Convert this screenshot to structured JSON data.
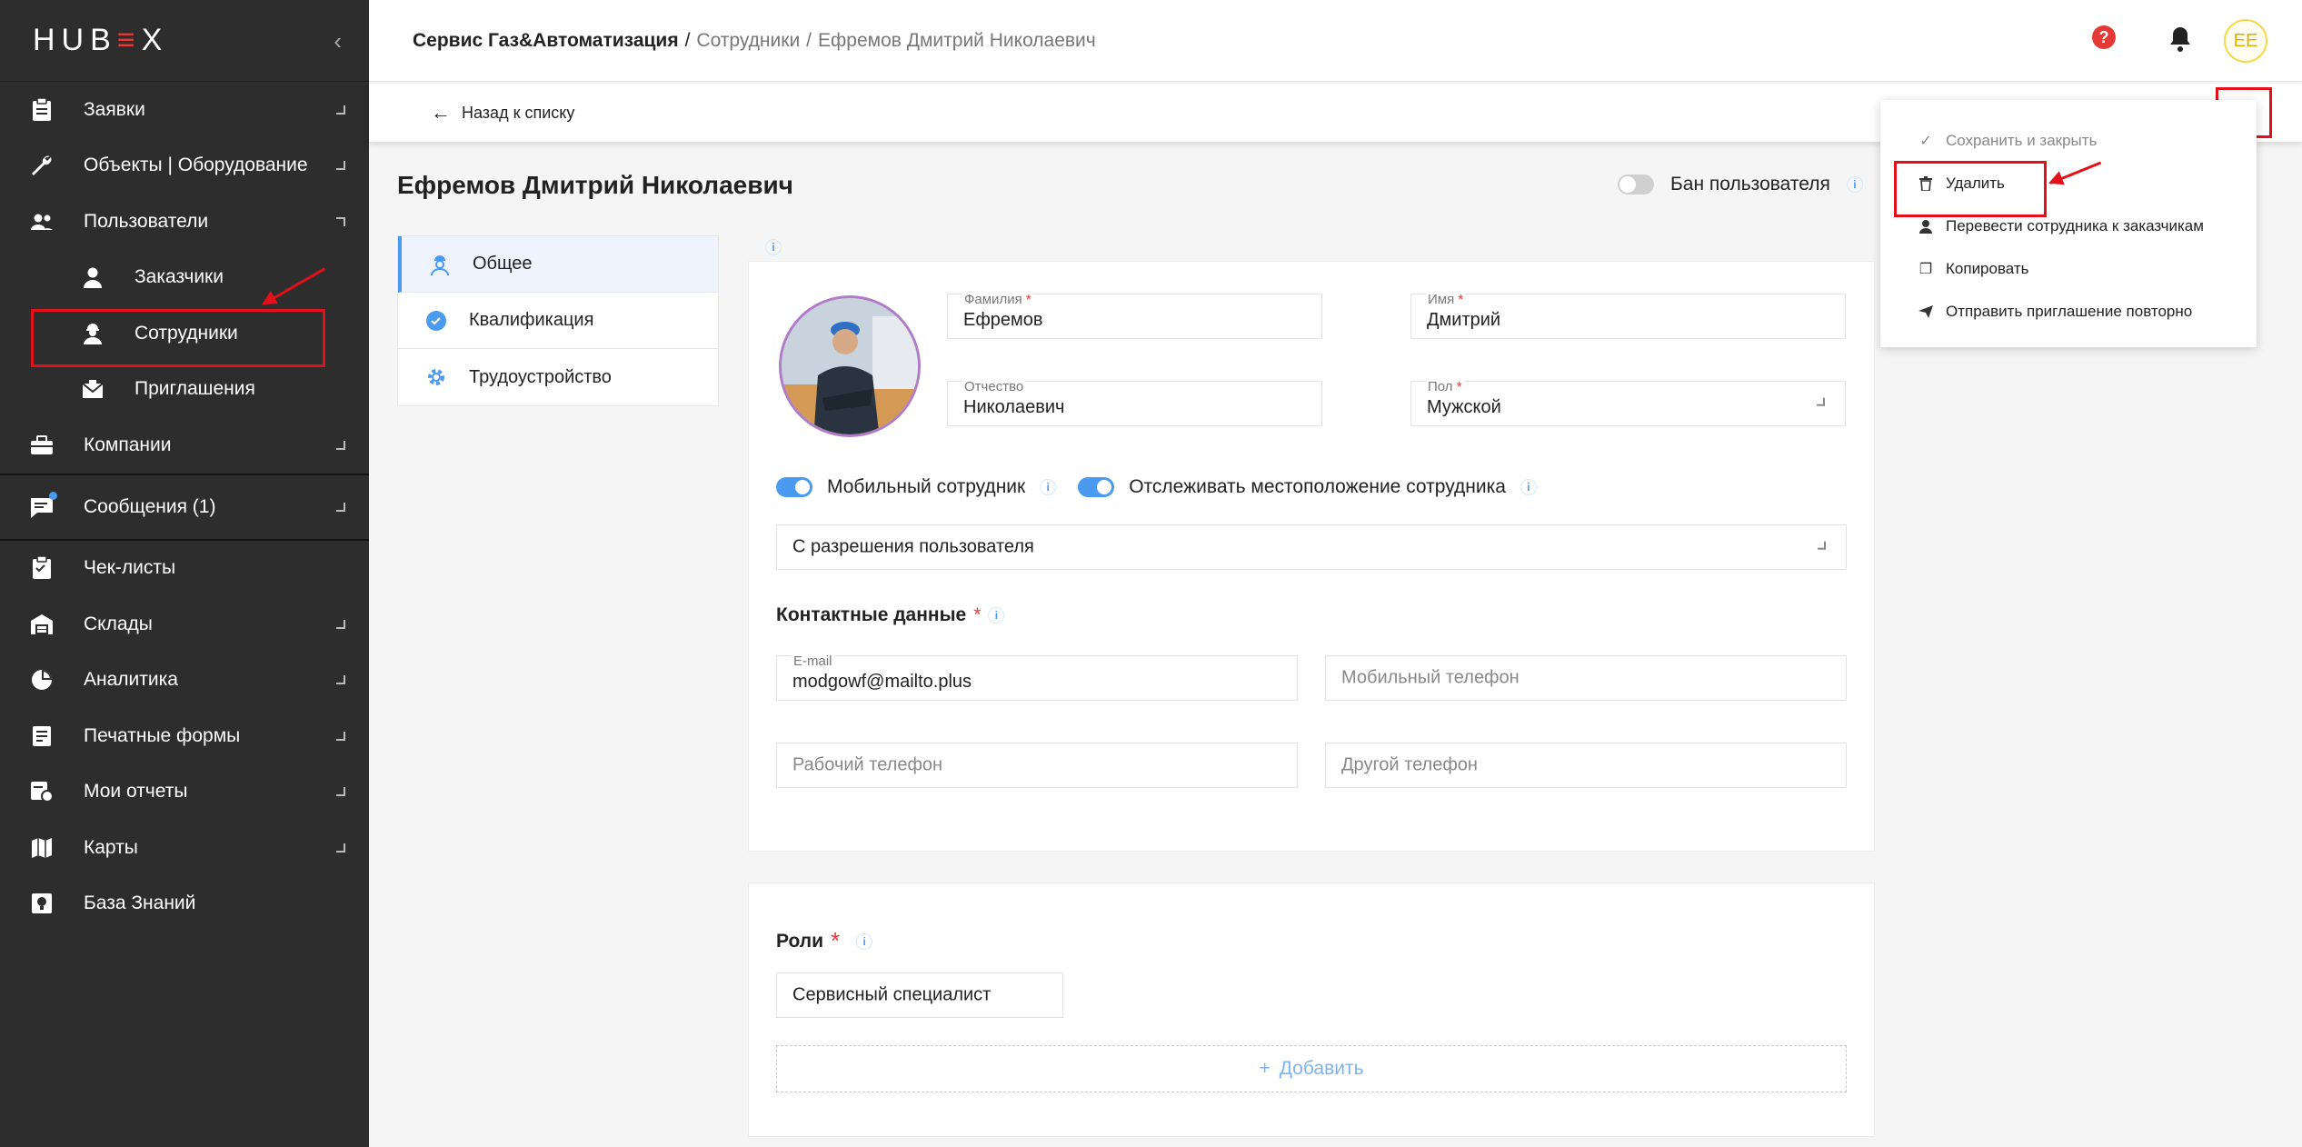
{
  "app": {
    "logo_left": "HUB",
    "logo_x": "≡",
    "logo_right": "X",
    "collapse_icon": "chevron-left-icon"
  },
  "sidebar": {
    "items": [
      {
        "label": "Заявки",
        "icon": "clipboard-icon"
      },
      {
        "label": "Объекты | Оборудование",
        "icon": "wrench-icon"
      },
      {
        "label": "Пользователи",
        "icon": "users-icon"
      },
      {
        "label": "Заказчики",
        "icon": "customer-icon"
      },
      {
        "label": "Сотрудники",
        "icon": "employee-icon"
      },
      {
        "label": "Приглашения",
        "icon": "invitation-icon"
      },
      {
        "label": "Компании",
        "icon": "briefcase-icon"
      },
      {
        "label": "Сообщения (1)",
        "icon": "message-icon"
      },
      {
        "label": "Чек-листы",
        "icon": "checklist-icon"
      },
      {
        "label": "Склады",
        "icon": "warehouse-icon"
      },
      {
        "label": "Аналитика",
        "icon": "pie-chart-icon"
      },
      {
        "label": "Печатные формы",
        "icon": "print-form-icon"
      },
      {
        "label": "Мои отчеты",
        "icon": "report-icon"
      },
      {
        "label": "Карты",
        "icon": "map-icon"
      },
      {
        "label": "База Знаний",
        "icon": "knowledge-icon"
      }
    ]
  },
  "topbar": {
    "breadcrumb": [
      "Сервис Газ&Автоматизация",
      "Сотрудники",
      "Ефремов Дмитрий Николаевич"
    ],
    "separator": "/",
    "help_icon": "?",
    "avatar_initials": "ЕЕ"
  },
  "actionbar": {
    "back_label": "Назад к списку",
    "back_arrow": "←"
  },
  "dropdown": {
    "items": [
      {
        "label": "Сохранить и закрыть",
        "icon": "✓"
      },
      {
        "label": "Удалить",
        "icon": "🗑"
      },
      {
        "label": "Перевести сотрудника к заказчикам",
        "icon": "👤"
      },
      {
        "label": "Копировать",
        "icon": "❐"
      },
      {
        "label": "Отправить приглашение повторно",
        "icon": "➤"
      }
    ]
  },
  "page": {
    "title": "Ефремов Дмитрий Николаевич",
    "ban_label": "Бан пользователя",
    "info": "i"
  },
  "tabs": [
    {
      "label": "Общее"
    },
    {
      "label": "Квалификация"
    },
    {
      "label": "Трудоустройство"
    }
  ],
  "form": {
    "last_name": {
      "label": "Фамилия",
      "value": "Ефремов",
      "required": "*"
    },
    "first_name": {
      "label": "Имя",
      "value": "Дмитрий",
      "required": "*"
    },
    "patronymic": {
      "label": "Отчество",
      "value": "Николаевич"
    },
    "gender": {
      "label": "Пол",
      "value": "Мужской",
      "required": "*"
    },
    "mobile_employee": {
      "label": "Мобильный сотрудник",
      "on": true
    },
    "track_location": {
      "label": "Отслеживать местоположение сотрудника",
      "on": true
    },
    "location_mode": {
      "value": "С разрешения пользователя"
    },
    "contacts_title": "Контактные данные",
    "email": {
      "label": "E-mail",
      "value": "modgowf@mailto.plus"
    },
    "mobile_phone": {
      "placeholder": "Мобильный телефон"
    },
    "work_phone": {
      "placeholder": "Рабочий телефон"
    },
    "other_phone": {
      "placeholder": "Другой телефон"
    }
  },
  "roles": {
    "title": "Роли",
    "required": "*",
    "items": [
      "Сервисный специалист"
    ],
    "add_label": "Добавить",
    "add_icon": "+"
  },
  "colors": {
    "accent": "#4a9bf0",
    "danger": "#e53935",
    "highlight_box": "#e3101a",
    "sidebar_bg": "#2d2d2d"
  }
}
